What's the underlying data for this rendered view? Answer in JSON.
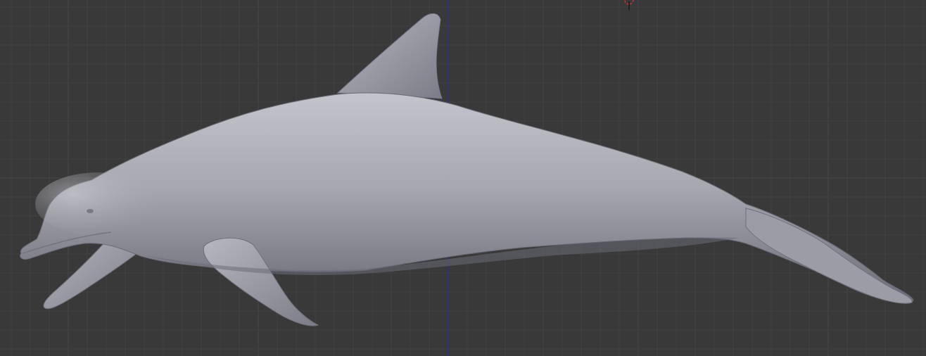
{
  "viewport": {
    "background": "#393939",
    "grid_minor_color": "#414141",
    "grid_major_color": "#464646",
    "z_axis_color": "#2f2f80",
    "cursor_color": "#d23030"
  },
  "model": {
    "icon": "3d-cursor-icon",
    "body_color": "#a7a7b0",
    "highlight_color": "#c4c4cc",
    "shadow_color": "#6a6a76"
  }
}
